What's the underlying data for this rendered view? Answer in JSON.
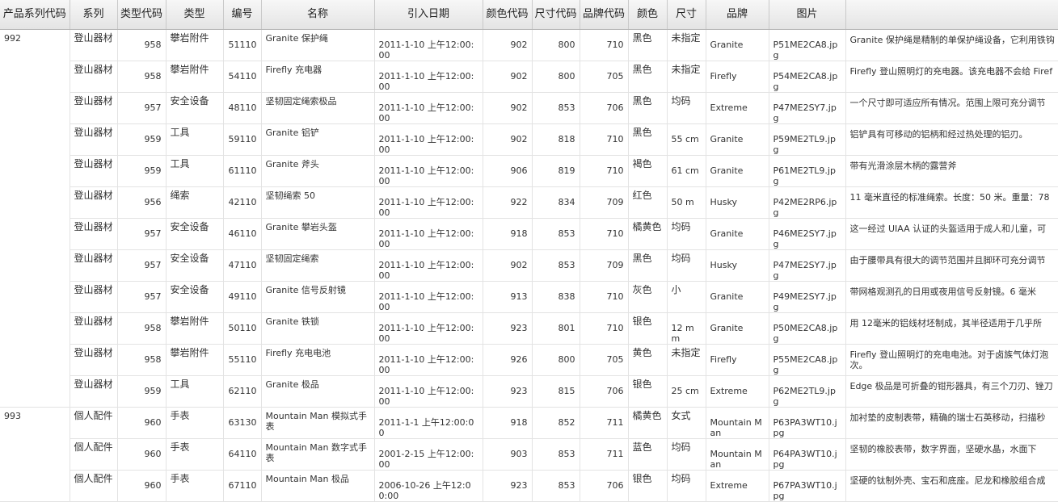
{
  "columns": [
    "产品系列代码",
    "系列",
    "类型代码",
    "类型",
    "编号",
    "名称",
    "引入日期",
    "颜色代码",
    "尺寸代码",
    "品牌代码",
    "颜色",
    "尺寸",
    "品牌",
    "图片",
    ""
  ],
  "rows": [
    {
      "line": "992",
      "series": "登山器材",
      "type_code": "958",
      "type": "攀岩附件",
      "number": "51110",
      "name": "Granite 保护绳",
      "date": "2011-1-10 上午12:00:00",
      "color_code": "902",
      "size_code": "800",
      "brand_code": "710",
      "color": "黑色",
      "size": "未指定",
      "brand": "Granite",
      "image": "P51ME2CA8.jpg",
      "desc": "Granite 保护绳是精制的单保护绳设备，它利用铁钩"
    },
    {
      "line": "",
      "series": "登山器材",
      "type_code": "958",
      "type": "攀岩附件",
      "number": "54110",
      "name": "Firefly 充电器",
      "date": "2011-1-10 上午12:00:00",
      "color_code": "902",
      "size_code": "800",
      "brand_code": "705",
      "color": "黑色",
      "size": "未指定",
      "brand": "Firefly",
      "image": "P54ME2CA8.jpg",
      "desc": "Firefly 登山照明灯的充电器。该充电器不会给 Firef"
    },
    {
      "line": "",
      "series": "登山器材",
      "type_code": "957",
      "type": "安全设备",
      "number": "48110",
      "name": "坚韧固定绳索极品",
      "date": "2011-1-10 上午12:00:00",
      "color_code": "902",
      "size_code": "853",
      "brand_code": "706",
      "color": "黑色",
      "size": "均码",
      "brand": "Extreme",
      "image": "P47ME2SY7.jpg",
      "desc": "一个尺寸即可适应所有情况。范围上限可充分调节"
    },
    {
      "line": "",
      "series": "登山器材",
      "type_code": "959",
      "type": "工具",
      "number": "59110",
      "name": "Granite 铝铲",
      "date": "2011-1-10 上午12:00:00",
      "color_code": "902",
      "size_code": "818",
      "brand_code": "710",
      "color": "黑色",
      "size": "55 cm",
      "brand": "Granite",
      "image": "P59ME2TL9.jpg",
      "desc": "铝铲具有可移动的铝柄和经过热处理的铝刃。"
    },
    {
      "line": "",
      "series": "登山器材",
      "type_code": "959",
      "type": "工具",
      "number": "61110",
      "name": "Granite 斧头",
      "date": "2011-1-10 上午12:00:00",
      "color_code": "906",
      "size_code": "819",
      "brand_code": "710",
      "color": "褐色",
      "size": "61 cm",
      "brand": "Granite",
      "image": "P61ME2TL9.jpg",
      "desc": "带有光滑涂层木柄的露营斧"
    },
    {
      "line": "",
      "series": "登山器材",
      "type_code": "956",
      "type": "绳索",
      "number": "42110",
      "name": "坚韧绳索 50",
      "date": "2011-1-10 上午12:00:00",
      "color_code": "922",
      "size_code": "834",
      "brand_code": "709",
      "color": "红色",
      "size": "50 m",
      "brand": "Husky",
      "image": "P42ME2RP6.jpg",
      "desc": "11 毫米直径的标准绳索。长度：50 米。重量：78"
    },
    {
      "line": "",
      "series": "登山器材",
      "type_code": "957",
      "type": "安全设备",
      "number": "46110",
      "name": "Granite 攀岩头盔",
      "date": "2011-1-10 上午12:00:00",
      "color_code": "918",
      "size_code": "853",
      "brand_code": "710",
      "color": "橘黄色",
      "size": "均码",
      "brand": "Granite",
      "image": "P46ME2SY7.jpg",
      "desc": "这一经过 UIAA 认证的头盔适用于成人和儿童，可"
    },
    {
      "line": "",
      "series": "登山器材",
      "type_code": "957",
      "type": "安全设备",
      "number": "47110",
      "name": "坚韧固定绳索",
      "date": "2011-1-10 上午12:00:00",
      "color_code": "902",
      "size_code": "853",
      "brand_code": "709",
      "color": "黑色",
      "size": "均码",
      "brand": "Husky",
      "image": "P47ME2SY7.jpg",
      "desc": "由于腰带具有很大的调节范围并且脚环可充分调节"
    },
    {
      "line": "",
      "series": "登山器材",
      "type_code": "957",
      "type": "安全设备",
      "number": "49110",
      "name": "Granite 信号反射镜",
      "date": "2011-1-10 上午12:00:00",
      "color_code": "913",
      "size_code": "838",
      "brand_code": "710",
      "color": "灰色",
      "size": "小",
      "brand": "Granite",
      "image": "P49ME2SY7.jpg",
      "desc": "带网格观测孔的日用或夜用信号反射镜。6 毫米"
    },
    {
      "line": "",
      "series": "登山器材",
      "type_code": "958",
      "type": "攀岩附件",
      "number": "50110",
      "name": "Granite 铁锁",
      "date": "2011-1-10 上午12:00:00",
      "color_code": "923",
      "size_code": "801",
      "brand_code": "710",
      "color": "银色",
      "size": "12 mm",
      "brand": "Granite",
      "image": "P50ME2CA8.jpg",
      "desc": "用 12毫米的铝线材坯制成，其半径适用于几乎所"
    },
    {
      "line": "",
      "series": "登山器材",
      "type_code": "958",
      "type": "攀岩附件",
      "number": "55110",
      "name": "Firefly 充电电池",
      "date": "2011-1-10 上午12:00:00",
      "color_code": "926",
      "size_code": "800",
      "brand_code": "705",
      "color": "黄色",
      "size": "未指定",
      "brand": "Firefly",
      "image": "P55ME2CA8.jpg",
      "desc": "Firefly 登山照明灯的充电电池。对于卤族气体灯泡",
      "desc2": "次。"
    },
    {
      "line": "",
      "series": "登山器材",
      "type_code": "959",
      "type": "工具",
      "number": "62110",
      "name": "Granite 极品",
      "date": "2011-1-10 上午12:00:00",
      "color_code": "923",
      "size_code": "815",
      "brand_code": "706",
      "color": "银色",
      "size": "25 cm",
      "brand": "Extreme",
      "image": "P62ME2TL9.jpg",
      "desc": "Edge 极品是可折叠的钳形器具，有三个刀刃、锉刀"
    },
    {
      "line": "993",
      "series": "個人配件",
      "type_code": "960",
      "type": "手表",
      "number": "63130",
      "name": "Mountain Man 模拟式手表",
      "date": "2011-1-1 上午12:00:00",
      "color_code": "918",
      "size_code": "852",
      "brand_code": "711",
      "color": "橘黄色",
      "size": "女式",
      "brand": "Mountain Man",
      "image": "P63PA3WT10.jpg",
      "desc": "加衬垫的皮制表带，精确的瑞士石英移动，扫描秒"
    },
    {
      "line": "",
      "series": "個人配件",
      "type_code": "960",
      "type": "手表",
      "number": "64110",
      "name": "Mountain Man 数字式手表",
      "date": "2001-2-15 上午12:00:00",
      "color_code": "903",
      "size_code": "853",
      "brand_code": "711",
      "color": "蓝色",
      "size": "均码",
      "brand": "Mountain Man",
      "image": "P64PA3WT10.jpg",
      "desc": "坚韧的橡胶表带，数字界面，坚硬水晶，水面下"
    },
    {
      "line": "",
      "series": "個人配件",
      "type_code": "960",
      "type": "手表",
      "number": "67110",
      "name": "Mountain Man 极品",
      "date": "2006-10-26 上午12:00:00",
      "color_code": "923",
      "size_code": "853",
      "brand_code": "706",
      "color": "银色",
      "size": "均码",
      "brand": "Extreme",
      "image": "P67PA3WT10.jpg",
      "desc": "坚硬的钛制外壳、宝石和底座。尼龙和橡胶组合成"
    }
  ]
}
